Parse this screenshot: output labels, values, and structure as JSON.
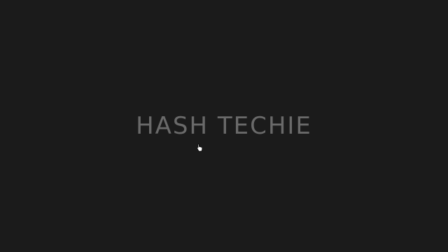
{
  "title": {
    "text": "HASH TECHIE",
    "color": "#6a6a6a"
  },
  "background_color": "#1b1b1b",
  "cursor": {
    "icon": "hand-pointer-icon"
  }
}
